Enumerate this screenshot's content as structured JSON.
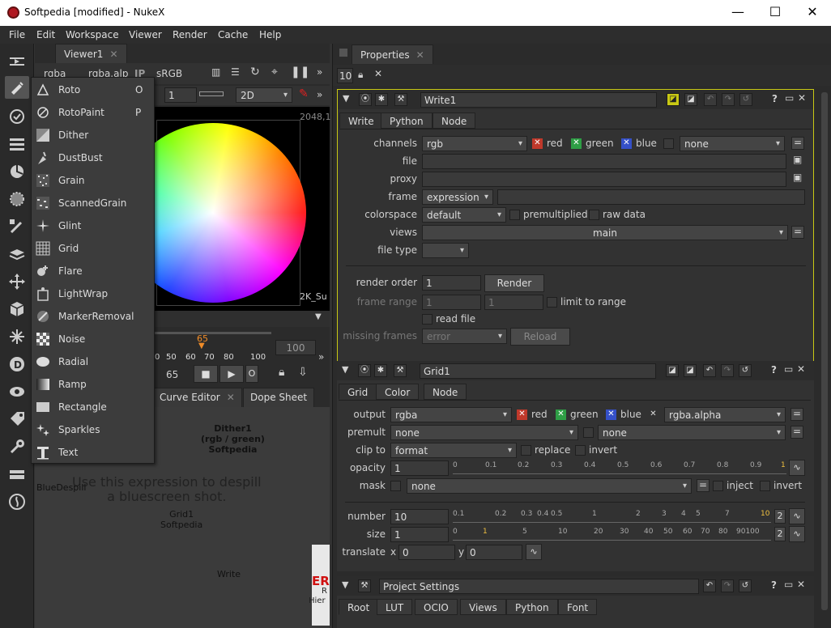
{
  "window": {
    "title": "Softpedia [modified] - NukeX"
  },
  "menubar": [
    "File",
    "Edit",
    "Workspace",
    "Viewer",
    "Render",
    "Cache",
    "Help"
  ],
  "viewer": {
    "tab": "Viewer1",
    "channels": "rgba",
    "alpha_channel": "rgba.alp",
    "ip": "IP",
    "colorspace": "sRGB",
    "gain": "1",
    "mode": "2D",
    "res_top": "2048,1",
    "res_bottom": "2K_Su",
    "timeline_current": "65",
    "timeline_ticks": [
      "0",
      "50",
      "60",
      "70",
      "80",
      "100"
    ],
    "timeline_end": "100",
    "frame_field": "65",
    "frame_o": "O"
  },
  "draw_menu": {
    "items": [
      {
        "label": "Roto",
        "shortcut": "O",
        "icon": "roto-icon"
      },
      {
        "label": "RotoPaint",
        "shortcut": "P",
        "icon": "rotopaint-icon"
      },
      {
        "label": "Dither",
        "shortcut": "",
        "icon": "dither-icon"
      },
      {
        "label": "DustBust",
        "shortcut": "",
        "icon": "dustbust-icon"
      },
      {
        "label": "Grain",
        "shortcut": "",
        "icon": "grain-icon"
      },
      {
        "label": "ScannedGrain",
        "shortcut": "",
        "icon": "scannedgrain-icon"
      },
      {
        "label": "Glint",
        "shortcut": "",
        "icon": "glint-icon"
      },
      {
        "label": "Grid",
        "shortcut": "",
        "icon": "grid-icon"
      },
      {
        "label": "Flare",
        "shortcut": "",
        "icon": "flare-icon"
      },
      {
        "label": "LightWrap",
        "shortcut": "",
        "icon": "lightwrap-icon"
      },
      {
        "label": "MarkerRemoval",
        "shortcut": "",
        "icon": "markerremoval-icon"
      },
      {
        "label": "Noise",
        "shortcut": "",
        "icon": "noise-icon"
      },
      {
        "label": "Radial",
        "shortcut": "",
        "icon": "radial-icon"
      },
      {
        "label": "Ramp",
        "shortcut": "",
        "icon": "ramp-icon"
      },
      {
        "label": "Rectangle",
        "shortcut": "",
        "icon": "rectangle-icon"
      },
      {
        "label": "Sparkles",
        "shortcut": "",
        "icon": "sparkles-icon"
      },
      {
        "label": "Text",
        "shortcut": "",
        "icon": "text-icon"
      }
    ]
  },
  "node_graph": {
    "tabs": [
      "Curve Editor",
      "Dope Sheet"
    ],
    "node_dither": "Dither1\n(rgb / green)\nSoftpedia",
    "sticky_note": "Use this expression to despill\na bluescreen shot.",
    "bluedespill": "BlueDespill",
    "node_grid": "Grid1\nSoftpedia",
    "node_write": "Write",
    "err": "ER",
    "r": "R",
    "hier": "Hier"
  },
  "properties": {
    "tab": "Properties",
    "max_panels": "10",
    "write": {
      "name": "Write1",
      "tabs": [
        "Write",
        "Python",
        "Node"
      ],
      "channels_label": "channels",
      "channels_value": "rgb",
      "red": "red",
      "green": "green",
      "blue": "blue",
      "alpha_drop": "none",
      "file_label": "file",
      "proxy_label": "proxy",
      "frame_label": "frame",
      "frame_value": "expression",
      "colorspace_label": "colorspace",
      "colorspace_value": "default",
      "premultiplied": "premultiplied",
      "raw_data": "raw data",
      "views_label": "views",
      "views_value": "main",
      "filetype_label": "file type",
      "render_order_label": "render order",
      "render_order_value": "1",
      "render_button": "Render",
      "frame_range_label": "frame range",
      "frame_range_a": "1",
      "frame_range_b": "1",
      "limit_to_range": "limit to range",
      "read_file": "read file",
      "missing_frames_label": "missing frames",
      "missing_frames_value": "error",
      "reload_button": "Reload"
    },
    "grid": {
      "name": "Grid1",
      "tabs": [
        "Grid",
        "Color",
        "Node"
      ],
      "output_label": "output",
      "output_value": "rgba",
      "red": "red",
      "green": "green",
      "blue": "blue",
      "alpha_value": "rgba.alpha",
      "premult_label": "premult",
      "premult_value": "none",
      "premult_value2": "none",
      "clipto_label": "clip to",
      "clipto_value": "format",
      "replace": "replace",
      "invert": "invert",
      "opacity_label": "opacity",
      "opacity_value": "1",
      "opacity_ticks": [
        "0",
        "0.1",
        "0.2",
        "0.3",
        "0.4",
        "0.5",
        "0.6",
        "0.7",
        "0.8",
        "0.9",
        "1"
      ],
      "mask_label": "mask",
      "mask_value": "none",
      "inject": "inject",
      "mask_invert": "invert",
      "number_label": "number",
      "number_value": "10",
      "number_ticks": [
        "0.1",
        "0.2",
        "0.3",
        "0.4",
        "0.5",
        "1",
        "2",
        "3",
        "4",
        "5",
        "7",
        "10"
      ],
      "size_label": "size",
      "size_value": "1",
      "size_ticks": [
        "0",
        "1",
        "5",
        "10",
        "20",
        "30",
        "40",
        "50",
        "60",
        "70",
        "80",
        "90100"
      ],
      "translate_label": "translate",
      "x_label": "x",
      "x_value": "0",
      "y_label": "y",
      "y_value": "0",
      "anim_count": "2"
    },
    "project": {
      "name": "Project Settings",
      "tabs": [
        "Root",
        "LUT",
        "OCIO",
        "Views",
        "Python",
        "Font"
      ]
    }
  },
  "colors": {
    "accent_yellow": "#c8c814",
    "timeline_orange": "#f08c28",
    "red_check": "#c0392b",
    "green_check": "#2e9e45",
    "blue_check": "#3550c8"
  }
}
